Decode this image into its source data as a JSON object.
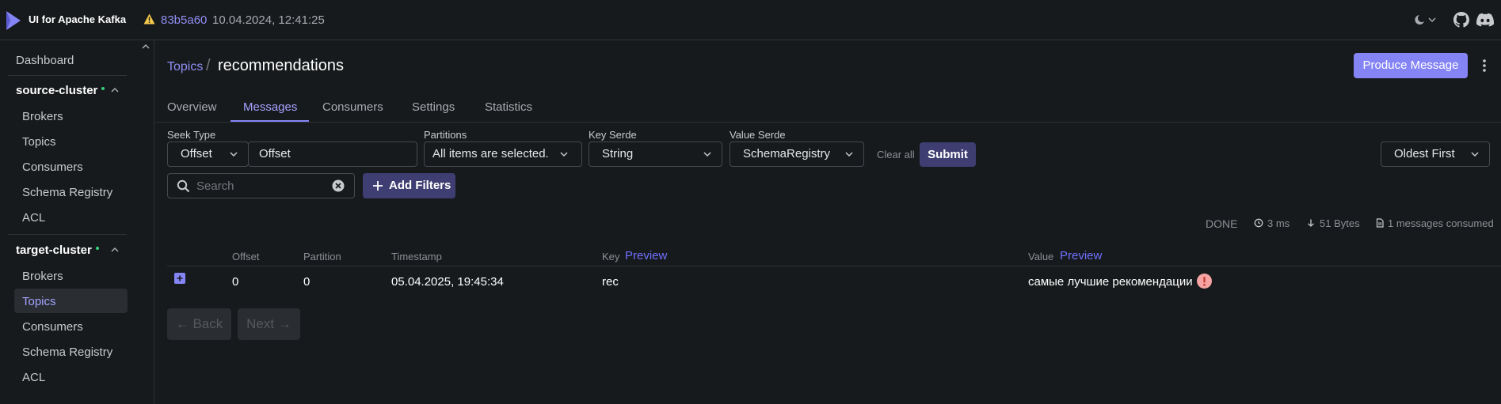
{
  "app": {
    "title": "UI for Apache Kafka",
    "version_hash": "83b5a60",
    "version_date": "10.04.2024, 12:41:25",
    "accent_color": "#8484f5"
  },
  "sidebar": {
    "dashboard": "Dashboard",
    "clusters": [
      {
        "name": "source-cluster",
        "status": "online",
        "items": [
          "Brokers",
          "Topics",
          "Consumers",
          "Schema Registry",
          "ACL"
        ]
      },
      {
        "name": "target-cluster",
        "status": "online",
        "items": [
          "Brokers",
          "Topics",
          "Consumers",
          "Schema Registry",
          "ACL"
        ],
        "active_item": "Topics"
      }
    ]
  },
  "header": {
    "breadcrumb": "Topics",
    "separator": "/",
    "title": "recommendations",
    "produce_button": "Produce Message"
  },
  "tabs": [
    "Overview",
    "Messages",
    "Consumers",
    "Settings",
    "Statistics"
  ],
  "active_tab": "Messages",
  "filters": {
    "seek_type_label": "Seek Type",
    "seek_type_value": "Offset",
    "offset_value": "Offset",
    "partitions_label": "Partitions",
    "partitions_value": "All items are selected.",
    "key_serde_label": "Key Serde",
    "key_serde_value": "String",
    "value_serde_label": "Value Serde",
    "value_serde_value": "SchemaRegistry",
    "clear_all": "Clear all",
    "submit": "Submit",
    "sort_value": "Oldest First",
    "search_placeholder": "Search",
    "add_filters": "Add Filters"
  },
  "status": {
    "state": "DONE",
    "elapsed": "3 ms",
    "bytes": "51 Bytes",
    "consumed": "1 messages consumed"
  },
  "table": {
    "columns": {
      "offset": "Offset",
      "partition": "Partition",
      "timestamp": "Timestamp",
      "key": "Key",
      "value": "Value",
      "preview": "Preview"
    },
    "rows": [
      {
        "offset": "0",
        "partition": "0",
        "timestamp": "05.04.2025, 19:45:34",
        "key": "rec",
        "value": "самые лучшие рекомендации"
      }
    ]
  },
  "pagination": {
    "back": "← Back",
    "next": "Next →"
  }
}
